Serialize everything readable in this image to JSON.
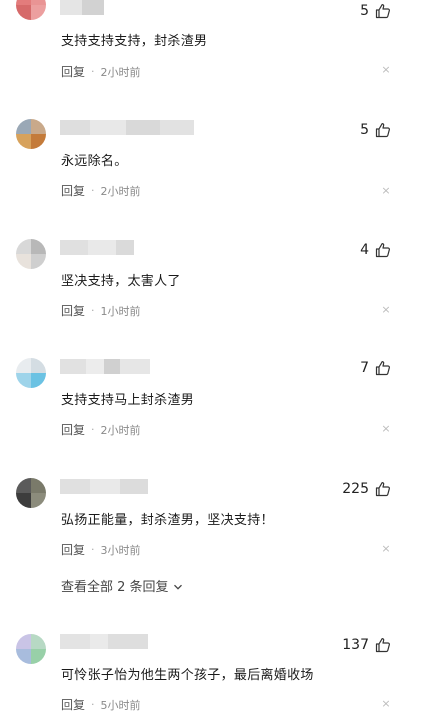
{
  "comments": [
    {
      "likes": "5",
      "text": "支持支持支持，封杀渣男",
      "reply": "回复",
      "time": "2小时前"
    },
    {
      "likes": "5",
      "text": "永远除名。",
      "reply": "回复",
      "time": "2小时前"
    },
    {
      "likes": "4",
      "text": "坚决支持，太害人了",
      "reply": "回复",
      "time": "1小时前"
    },
    {
      "likes": "7",
      "text": "支持支持马上封杀渣男",
      "reply": "回复",
      "time": "2小时前"
    },
    {
      "likes": "225",
      "text": "弘扬正能量，封杀渣男，坚决支持！",
      "reply": "回复",
      "time": "3小时前"
    },
    {
      "likes": "137",
      "text": "可怜张子怡为他生两个孩子，最后离婚收场",
      "reply": "回复",
      "time": "5小时前"
    }
  ],
  "view_all_replies": "查看全部 2 条回复",
  "close_symbol": "×",
  "dot_symbol": "·",
  "colors": {
    "text": "#1a1a1a",
    "meta": "#8a8a8a",
    "close": "#bbbbbb"
  }
}
